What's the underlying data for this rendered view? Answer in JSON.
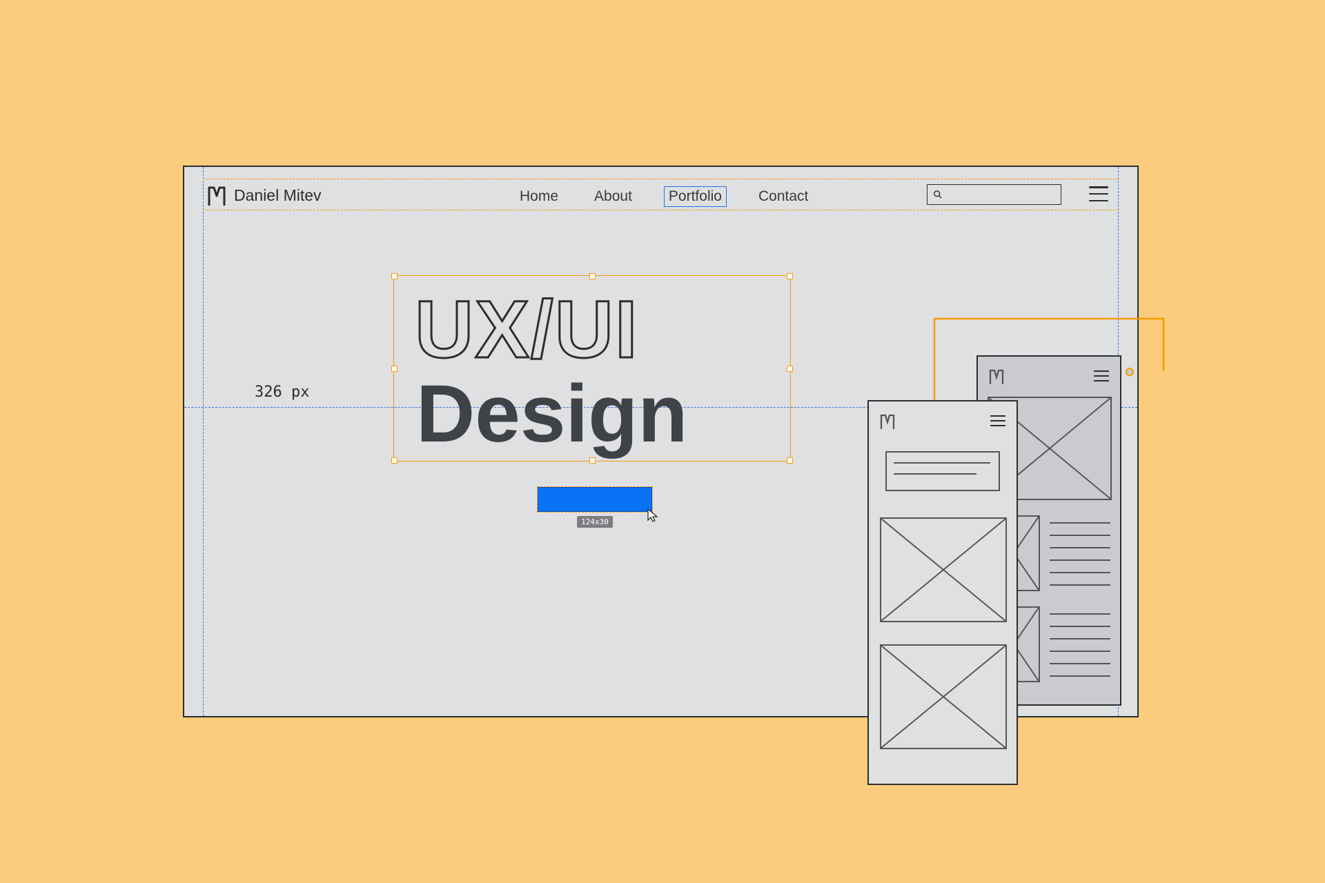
{
  "site": {
    "brand_name": "Daniel Mitev"
  },
  "nav": {
    "items": [
      {
        "label": "Home",
        "selected": false
      },
      {
        "label": "About",
        "selected": false
      },
      {
        "label": "Portfolio",
        "selected": true
      },
      {
        "label": "Contact",
        "selected": false
      }
    ]
  },
  "hero": {
    "line1": "UX/UI",
    "line2": "Design"
  },
  "measurement": {
    "horizontal_label": "326 px"
  },
  "cta": {
    "size_badge": "124x30"
  },
  "colors": {
    "accent_orange": "#F79A00",
    "guide_blue": "#3B6FD8",
    "button_blue": "#0A72F5",
    "canvas_bg": "#DEE0E2",
    "page_bg": "#FBCC7D",
    "text_dark": "#3F4246"
  }
}
